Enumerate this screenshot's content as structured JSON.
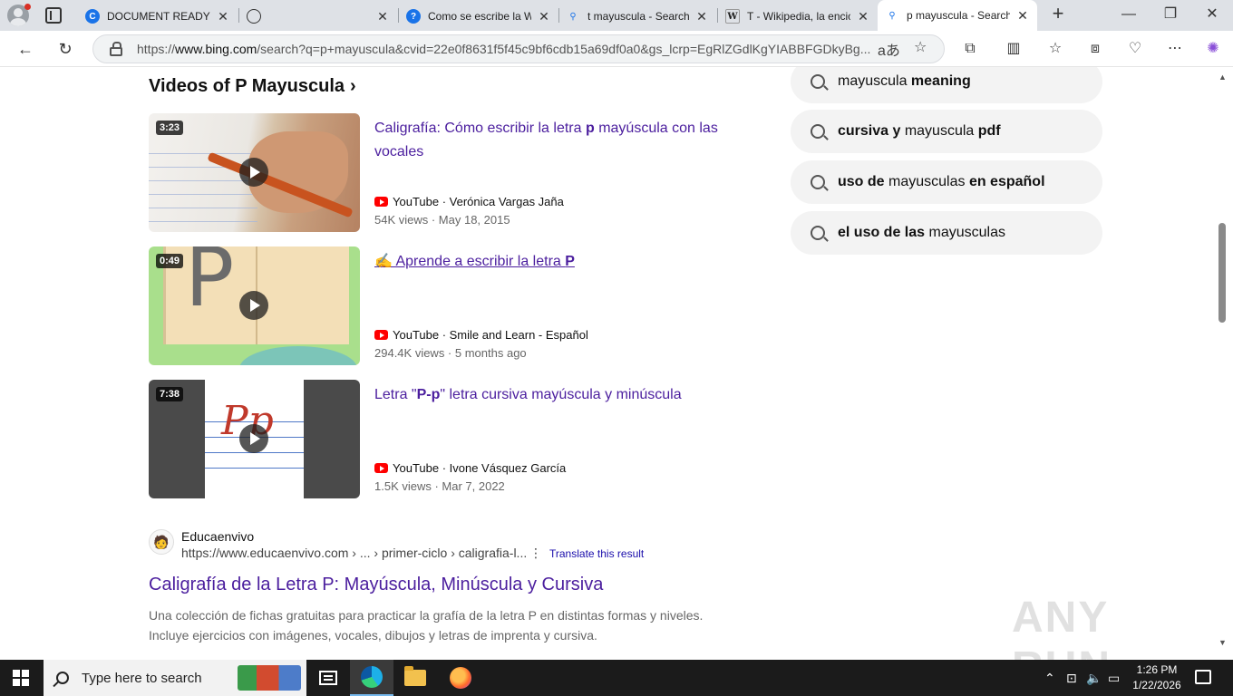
{
  "browser": {
    "tabs": [
      {
        "title": "DOCUMENT READY P",
        "favicon": "C",
        "favicon_color": "#1a73e8"
      },
      {
        "title": "",
        "favicon": "globe",
        "favicon_color": "#333333"
      },
      {
        "title": "Como se escribe la W",
        "favicon": "?",
        "favicon_color": "#1a73e8"
      },
      {
        "title": "t mayuscula - Search",
        "favicon": "search",
        "favicon_color": "#1a73e8"
      },
      {
        "title": "T - Wikipedia, la encic",
        "favicon": "W",
        "favicon_color": "#111111"
      },
      {
        "title": "p mayuscula - Search",
        "favicon": "search",
        "favicon_color": "#1a73e8",
        "active": true
      }
    ],
    "url": "https://www.bing.com/search?q=p+mayuscula&cvid=22e0f8631f5f45c9bf6cdb15a69df0a0&gs_lcrp=EgRlZGdlKgYIABBFGDkyBg...",
    "url_host": "www.bing.com",
    "url_prefix": "https://",
    "url_rest": "/search?q=p+mayuscula&cvid=22e0f8631f5f45c9bf6cdb15a69df0a0&gs_lcrp=EgRlZGdlKgYIABBFGDkyBg..."
  },
  "videos": {
    "heading": "Videos of P Mayuscula",
    "items": [
      {
        "duration": "3:23",
        "title_pre": "Caligrafía: Cómo escribir la letra ",
        "title_bold": "p",
        "title_post": " mayúscula con las vocales",
        "source": "YouTube · Verónica Vargas Jaña",
        "stats": "54K views · May 18, 2015"
      },
      {
        "duration": "0:49",
        "title_pre": "✍️ Aprende a escribir la letra ",
        "title_bold": "P",
        "title_post": "",
        "source": "YouTube · Smile and Learn - Español",
        "stats": "294.4K views · 5 months ago"
      },
      {
        "duration": "7:38",
        "title_pre": "Letra \"",
        "title_bold": "P-p",
        "title_post": "\" letra cursiva mayúscula y minúscula",
        "source": "YouTube · Ivone Vásquez García",
        "stats": "1.5K views · Mar 7, 2022"
      }
    ]
  },
  "result": {
    "site_name": "Educaenvivo",
    "site_url": "https://www.educaenvivo.com › ... › primer-ciclo › caligrafia-l...",
    "translate": "Translate this result",
    "title": "Caligrafía de la Letra P: Mayúscula, Minúscula y Cursiva",
    "snippet": "Una colección de fichas gratuitas para practicar la grafía de la letra P en distintas formas y niveles. Incluye ejercicios con imágenes, vocales, dibujos y letras de imprenta y cursiva."
  },
  "related": [
    {
      "pre": "",
      "bold1": "",
      "mid": "mayuscula ",
      "bold2": "meaning"
    },
    {
      "pre": "",
      "bold1": "cursiva y ",
      "mid": "mayuscula ",
      "bold2": "pdf"
    },
    {
      "pre": "",
      "bold1": "uso de ",
      "mid": "mayusculas ",
      "bold2": "en español"
    },
    {
      "pre": "",
      "bold1": "el uso de las ",
      "mid": "mayusculas",
      "bold2": ""
    }
  ],
  "watermark": "ANY RUN",
  "taskbar": {
    "search_placeholder": "Type here to search",
    "time": "1:26 PM",
    "date": "1/22/2026"
  }
}
